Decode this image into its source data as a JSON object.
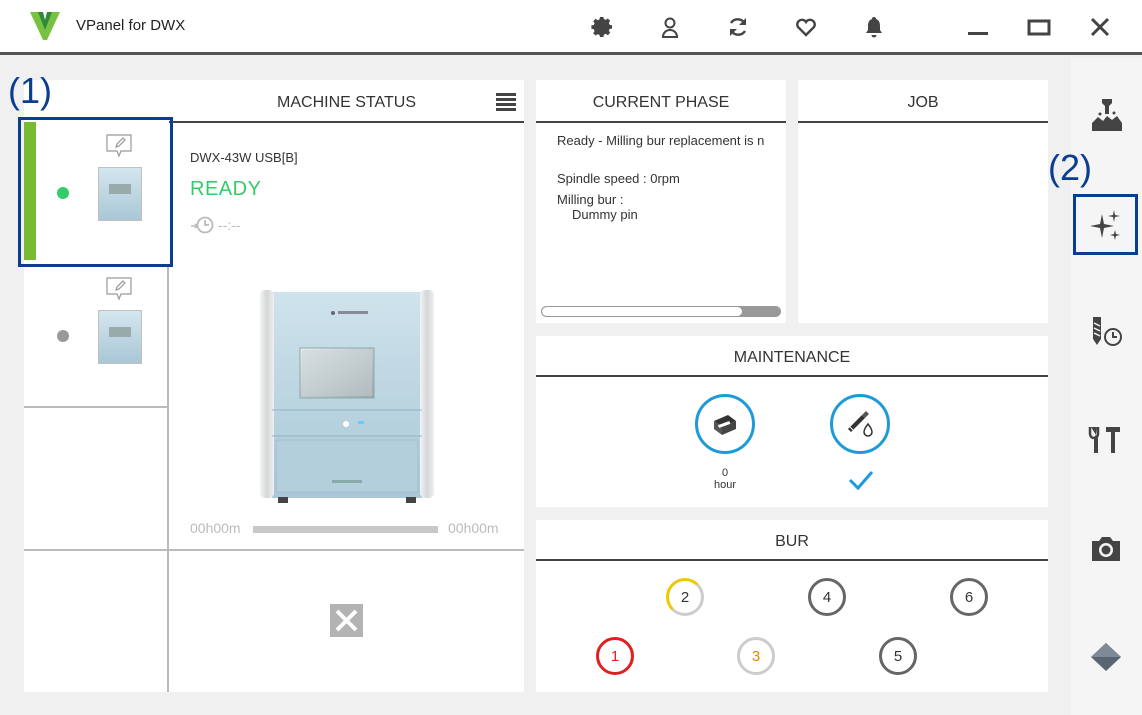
{
  "window": {
    "title": "VPanel for DWX",
    "toolbar_icons": [
      "settings-icon",
      "user-icon",
      "refresh-icon",
      "favorite-icon",
      "notification-icon"
    ],
    "window_controls": [
      "minimize-icon",
      "maximize-icon",
      "close-icon"
    ]
  },
  "callouts": {
    "one": "(1)",
    "two": "(2)"
  },
  "machine_status": {
    "title": "MACHINE STATUS",
    "model": "DWX-43W USB[B]",
    "state": "READY",
    "eta": "--:--",
    "elapsed": "00h00m",
    "remaining": "00h00m",
    "colors": {
      "ready_green": "#33cc66",
      "selected_bar": "#77bb33",
      "offline_dot": "#999999"
    }
  },
  "current_phase": {
    "title": "CURRENT PHASE",
    "message": "Ready - Milling bur replacement is n",
    "spindle": "Spindle speed : 0rpm",
    "bur_label": "Milling bur :",
    "bur_value": "Dummy pin",
    "progress_percent": 0
  },
  "job": {
    "title": "JOB"
  },
  "maintenance": {
    "title": "MAINTENANCE",
    "hours_value": "0",
    "hours_unit": "hour",
    "accent": "#1e9bd7"
  },
  "bur": {
    "title": "BUR",
    "items": [
      {
        "n": "1",
        "ring": "#e02020",
        "text": "#e02020"
      },
      {
        "n": "2",
        "ring": "#cccccc",
        "text": "#333333"
      },
      {
        "n": "3",
        "ring": "#cccccc",
        "text": "#e08a00"
      },
      {
        "n": "4",
        "ring": "#666666",
        "text": "#333333"
      },
      {
        "n": "5",
        "ring": "#666666",
        "text": "#333333"
      },
      {
        "n": "6",
        "ring": "#666666",
        "text": "#333333"
      }
    ]
  },
  "sidebar": {
    "items": [
      "milling-icon",
      "sparkle-icon",
      "bur-schedule-icon",
      "tools-icon",
      "camera-icon",
      "diamond-icon"
    ]
  }
}
